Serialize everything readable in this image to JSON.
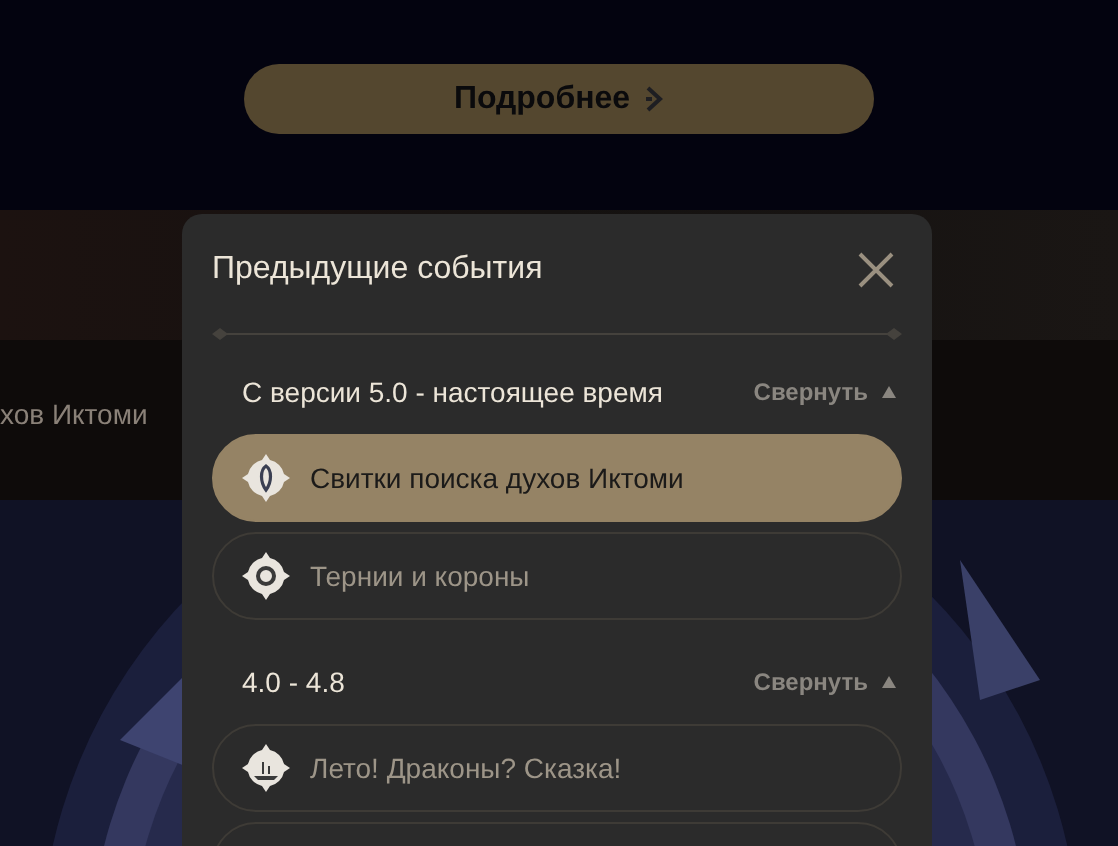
{
  "page": {
    "details_button": "Подробнее",
    "banner_caption": "хов Иктоми"
  },
  "modal": {
    "title": "Предыдущие события",
    "groups": [
      {
        "label": "С версии 5.0 - настоящее время",
        "toggle": "Свернуть",
        "expanded": true,
        "items": [
          {
            "title": "Свитки поиска духов Иктоми",
            "selected": true,
            "kind": "scroll"
          },
          {
            "title": "Тернии и короны",
            "selected": false,
            "kind": "spiral"
          }
        ]
      },
      {
        "label": "4.0 - 4.8",
        "toggle": "Свернуть",
        "expanded": true,
        "items": [
          {
            "title": "Лето! Драконы? Сказка!",
            "selected": false,
            "kind": "island"
          }
        ]
      }
    ]
  }
}
